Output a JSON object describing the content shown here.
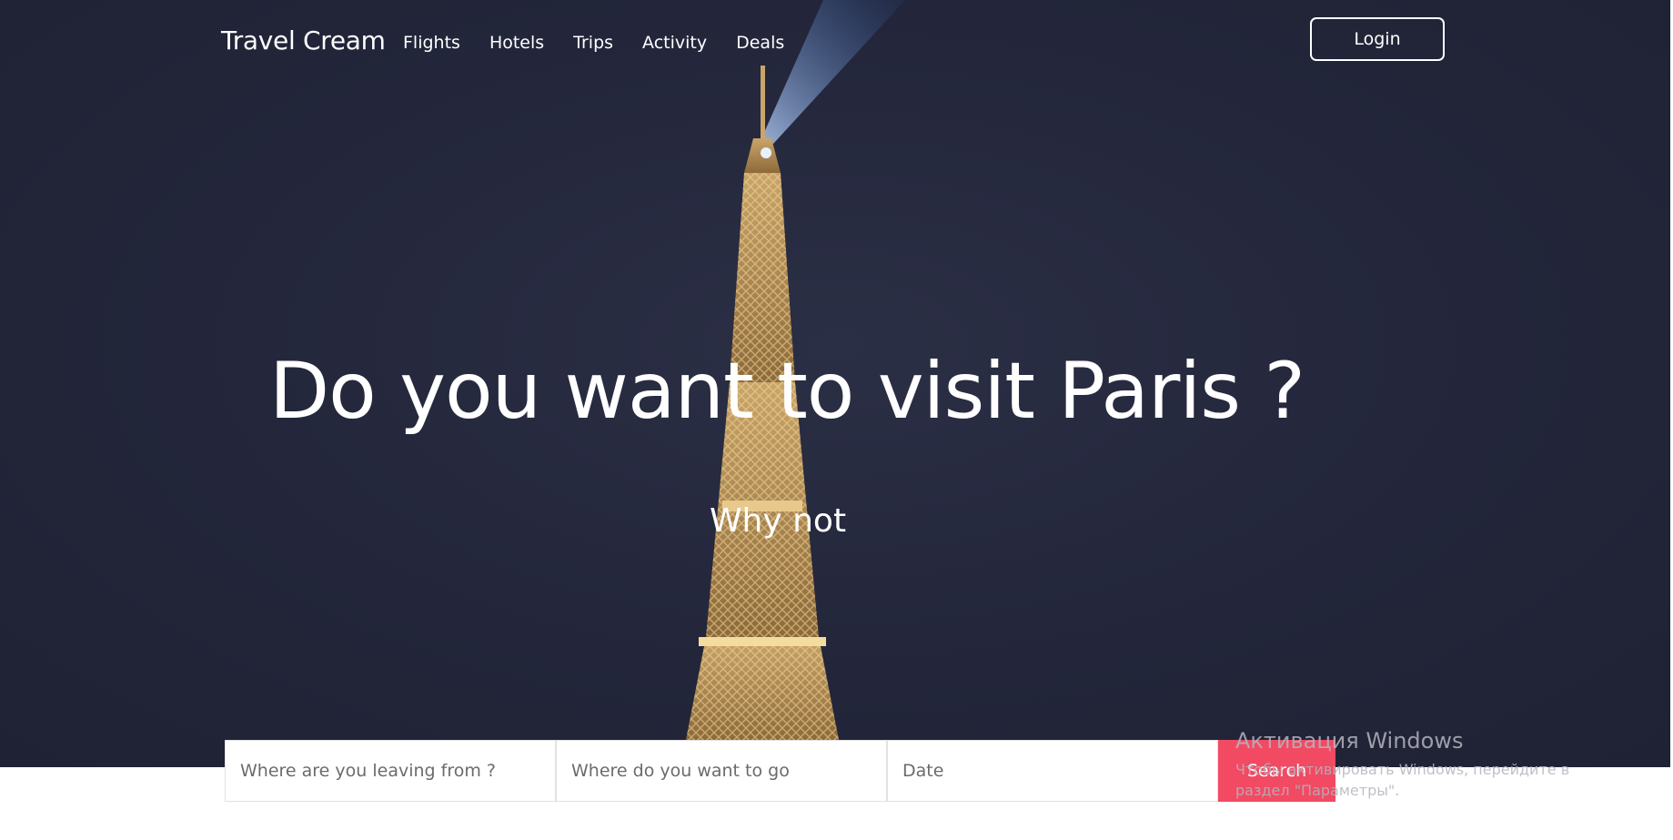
{
  "brand": "Travel Cream",
  "nav": {
    "links": [
      "Flights",
      "Hotels",
      "Trips",
      "Activity",
      "Deals"
    ],
    "login_label": "Login"
  },
  "hero": {
    "title": "Do you want to visit Paris ?",
    "subtitle": "Why not"
  },
  "search": {
    "from_placeholder": "Where are you leaving from ?",
    "to_placeholder": "Where do you want to go",
    "date_placeholder": "Date",
    "button_label": "Search"
  },
  "windows_watermark": {
    "title": "Активация Windows",
    "subtitle": "Чтобы активировать Windows, перейдите в раздел \"Параметры\"."
  },
  "colors": {
    "hero_background": "#23263a",
    "search_button": "#f24a63",
    "text_light": "#ffffff"
  }
}
